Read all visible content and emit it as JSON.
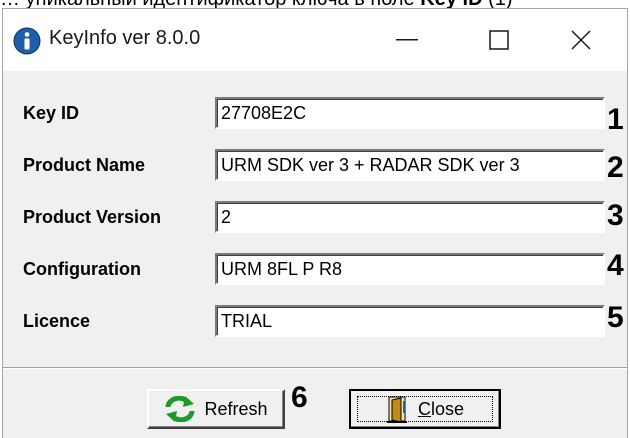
{
  "top_text": {
    "prefix": "… уникальный идентификатор ключа в поле ",
    "bold": "Key ID",
    "suffix": " (1)"
  },
  "window": {
    "title": "KeyInfo ver 8.0.0"
  },
  "titlebar": {
    "minimize": "—",
    "maximize": "☐",
    "close": "✕"
  },
  "rows": [
    {
      "label": "Key ID",
      "value": "27708E2C",
      "marker": "1"
    },
    {
      "label": "Product Name",
      "value": "URM SDK ver 3 + RADAR SDK ver 3",
      "marker": "2"
    },
    {
      "label": "Product Version",
      "value": "2",
      "marker": "3"
    },
    {
      "label": "Configuration",
      "value": "URM 8FL P R8",
      "marker": "4"
    },
    {
      "label": "Licence",
      "value": "TRIAL",
      "marker": "5"
    }
  ],
  "buttons": {
    "refresh": "Refresh",
    "refresh_marker": "6",
    "close_mnemonic": "C",
    "close_rest": "lose"
  },
  "colors": {
    "info_icon": "#1f5fa8",
    "refresh_icon": "#1e9a2a",
    "close_icon": "#c08a1a"
  },
  "icons": {
    "app": "info-icon",
    "refresh": "refresh-icon",
    "close": "door-exit-icon"
  }
}
